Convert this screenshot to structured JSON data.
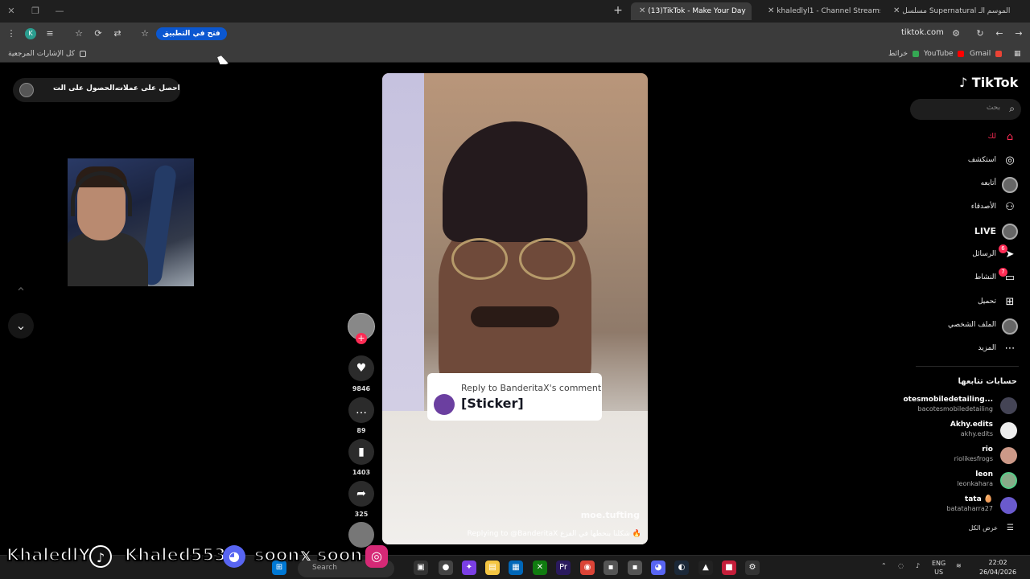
{
  "browser": {
    "tabs": [
      {
        "label": "مسلسل Supernatural الموسم الـ",
        "active": false
      },
      {
        "label": "khaledlyl1 - Channel Streams on",
        "active": false
      },
      {
        "label": "(13)TikTok - Make Your Day",
        "active": true
      }
    ],
    "open_in_app_label": "فتح في التطبيق",
    "url": "tiktok.com",
    "bookmarks_all_label": "كل الإشارات المرجعية",
    "bookmarks": [
      "Gmail",
      "YouTube",
      "خرائط"
    ]
  },
  "promo": {
    "get_app": "الحصول على الت...",
    "get_coins": "احصل على عملات"
  },
  "video": {
    "reply_title": "Reply to BanderitaX's comment",
    "reply_body": "[Sticker]",
    "watermark": "moe.tufting",
    "caption": "Replying to @BanderitaX شكلنا بنحطها في الفزع 🔥"
  },
  "actions": {
    "likes": "9846",
    "comments": "89",
    "saves": "1403",
    "shares": "325"
  },
  "sidebar": {
    "logo": "TikTok",
    "search_placeholder": "بحث",
    "items": [
      {
        "label": "لك",
        "icon": "home-icon"
      },
      {
        "label": "استكشف",
        "icon": "compass-icon"
      },
      {
        "label": "أتابعه",
        "icon": "avatar"
      },
      {
        "label": "الأصدقاء",
        "icon": "friends-icon"
      },
      {
        "label": "LIVE",
        "icon": "live-avatar"
      },
      {
        "label": "الرسائل",
        "icon": "send-icon",
        "badge": "6"
      },
      {
        "label": "النشاط",
        "icon": "comment-icon",
        "badge": "7"
      },
      {
        "label": "تحميل",
        "icon": "upload-icon"
      },
      {
        "label": "الملف الشخصي",
        "icon": "profile-avatar"
      },
      {
        "label": "المزيد",
        "icon": "more-icon"
      }
    ],
    "following_title": "حسابات تتابعها",
    "following": [
      {
        "name": "otesmobiledetailing...",
        "handle": "bacotesmobiledetailing"
      },
      {
        "name": "Akhy.edits",
        "handle": "akhy.edits"
      },
      {
        "name": "rio",
        "handle": "riolikesfrogs"
      },
      {
        "name": "leon",
        "handle": "leonkahara"
      },
      {
        "name": "tata 🥚",
        "handle": "batataharra27"
      }
    ],
    "see_all": "عرض الكل"
  },
  "taskbar": {
    "search_placeholder": "Search",
    "lang_top": "ENG",
    "lang_bottom": "US",
    "time": "22:02",
    "date": "26/04/2026"
  },
  "overlay": {
    "name1": "KhaledlYl1",
    "name2": "Khaled5534",
    "soon1": "soon",
    "soon2": "soon"
  },
  "colors": {
    "accent": "#fe2c55",
    "open_app_bg": "#0b57d0"
  }
}
